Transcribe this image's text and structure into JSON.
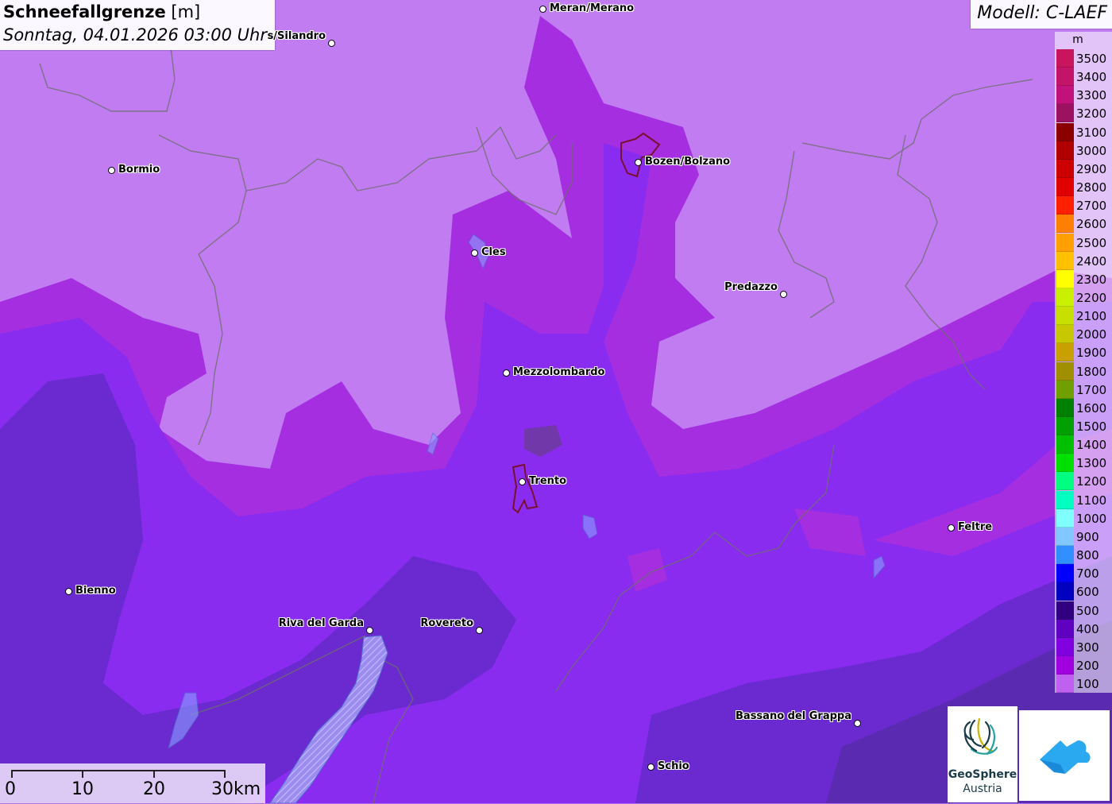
{
  "header": {
    "title": "Schneefallgrenze",
    "title_unit": "[m]",
    "datetime": "Sonntag, 04.01.2026 03:00 Uhr",
    "model": "Modell: C-LAEF"
  },
  "legend": {
    "unit": "m",
    "entries": [
      {
        "label": "3500",
        "color": "#c8155e"
      },
      {
        "label": "3400",
        "color": "#c4146a"
      },
      {
        "label": "3300",
        "color": "#c0127a"
      },
      {
        "label": "3200",
        "color": "#9a1260"
      },
      {
        "label": "3100",
        "color": "#8b0000"
      },
      {
        "label": "3000",
        "color": "#b00000"
      },
      {
        "label": "2900",
        "color": "#cc0000"
      },
      {
        "label": "2800",
        "color": "#e00000"
      },
      {
        "label": "2700",
        "color": "#ff2000"
      },
      {
        "label": "2600",
        "color": "#ff7f00"
      },
      {
        "label": "2500",
        "color": "#ffa000"
      },
      {
        "label": "2400",
        "color": "#ffc000"
      },
      {
        "label": "2300",
        "color": "#ffff00"
      },
      {
        "label": "2200",
        "color": "#c8f000"
      },
      {
        "label": "2100",
        "color": "#c8e000"
      },
      {
        "label": "2000",
        "color": "#c8c800"
      },
      {
        "label": "1900",
        "color": "#c8a000"
      },
      {
        "label": "1800",
        "color": "#a09000"
      },
      {
        "label": "1700",
        "color": "#70a000"
      },
      {
        "label": "1600",
        "color": "#008000"
      },
      {
        "label": "1500",
        "color": "#00a000"
      },
      {
        "label": "1400",
        "color": "#00c000"
      },
      {
        "label": "1300",
        "color": "#00e000"
      },
      {
        "label": "1200",
        "color": "#00ff80"
      },
      {
        "label": "1100",
        "color": "#00ffc0"
      },
      {
        "label": "1000",
        "color": "#80ffff"
      },
      {
        "label": "900",
        "color": "#80c8ff"
      },
      {
        "label": "800",
        "color": "#3090ff"
      },
      {
        "label": "700",
        "color": "#0000ff"
      },
      {
        "label": "600",
        "color": "#0000c0"
      },
      {
        "label": "500",
        "color": "#300080"
      },
      {
        "label": "400",
        "color": "#6000c0"
      },
      {
        "label": "300",
        "color": "#8000e0"
      },
      {
        "label": "200",
        "color": "#a000e0"
      },
      {
        "label": "100",
        "color": "#c060f0"
      }
    ]
  },
  "cities": [
    {
      "name": "Meran/Merano"
    },
    {
      "name": "s/Silandro"
    },
    {
      "name": "Bormio"
    },
    {
      "name": "Bozen/Bolzano"
    },
    {
      "name": "Cles"
    },
    {
      "name": "Predazzo"
    },
    {
      "name": "Mezzolombardo"
    },
    {
      "name": "Trento"
    },
    {
      "name": "Feltre"
    },
    {
      "name": "Bienno"
    },
    {
      "name": "Riva del Garda"
    },
    {
      "name": "Rovereto"
    },
    {
      "name": "Bassano del Grappa"
    },
    {
      "name": "Schio"
    }
  ],
  "scalebar": {
    "labels": [
      "0",
      "10",
      "20",
      "30km"
    ]
  },
  "logos": {
    "geosphere_line1": "GeoSphere",
    "geosphere_line2": "Austria"
  }
}
